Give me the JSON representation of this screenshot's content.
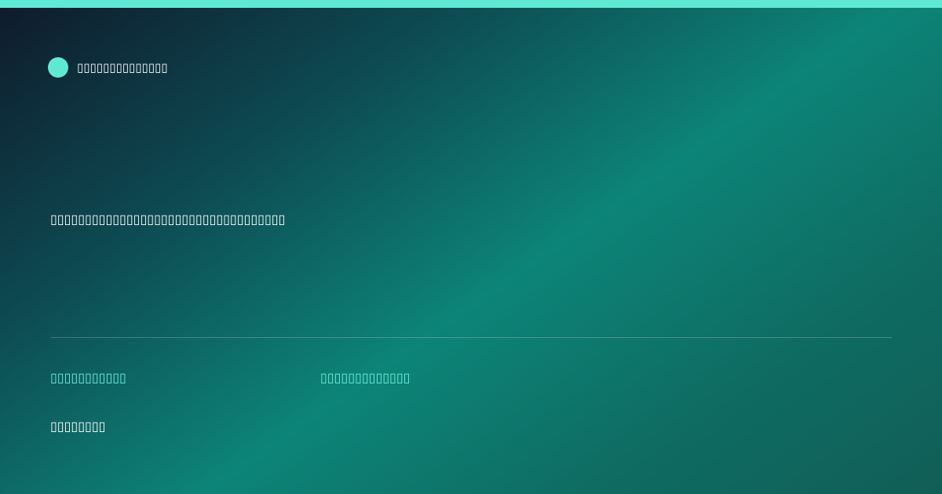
{
  "brand": {
    "name": "▯▯▯▯▯▯▯▯▯▯▯▯▯▯"
  },
  "main": {
    "headline": "▯▯▯▯▯▯▯▯▯▯▯▯▯▯▯▯▯▯▯▯▯▯▯▯▯▯▯▯▯▯▯▯▯▯"
  },
  "meta": {
    "left": "▯▯▯▯▯▯▯▯▯▯▯",
    "right": "▯▯▯▯▯▯▯▯▯▯▯▯▯"
  },
  "footer": {
    "note": "▯▯▯▯▯▯▯▯"
  },
  "theme": {
    "accent": "#5fe9d4",
    "accent_text": "#6ef1dc",
    "background_dark": "#0f1a2b",
    "background_mid": "#0d8478"
  }
}
